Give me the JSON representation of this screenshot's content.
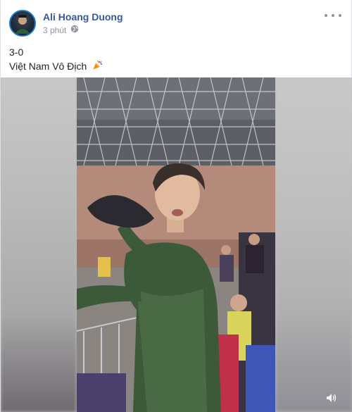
{
  "post": {
    "author": "Ali Hoang Duong",
    "time": "3 phút",
    "privacy_icon": "globe-icon",
    "more_icon": "more-options-icon",
    "text_line1": "3-0",
    "text_line2": "Việt Nam Vô Địch",
    "emoji": "party-popper-icon"
  },
  "video": {
    "description_icon": "video-frame",
    "sound_icon": "speaker-icon"
  },
  "colors": {
    "author_link": "#385898",
    "meta_text": "#90949c",
    "body_text": "#1d2129",
    "avatar_ring": "#1877c9"
  }
}
